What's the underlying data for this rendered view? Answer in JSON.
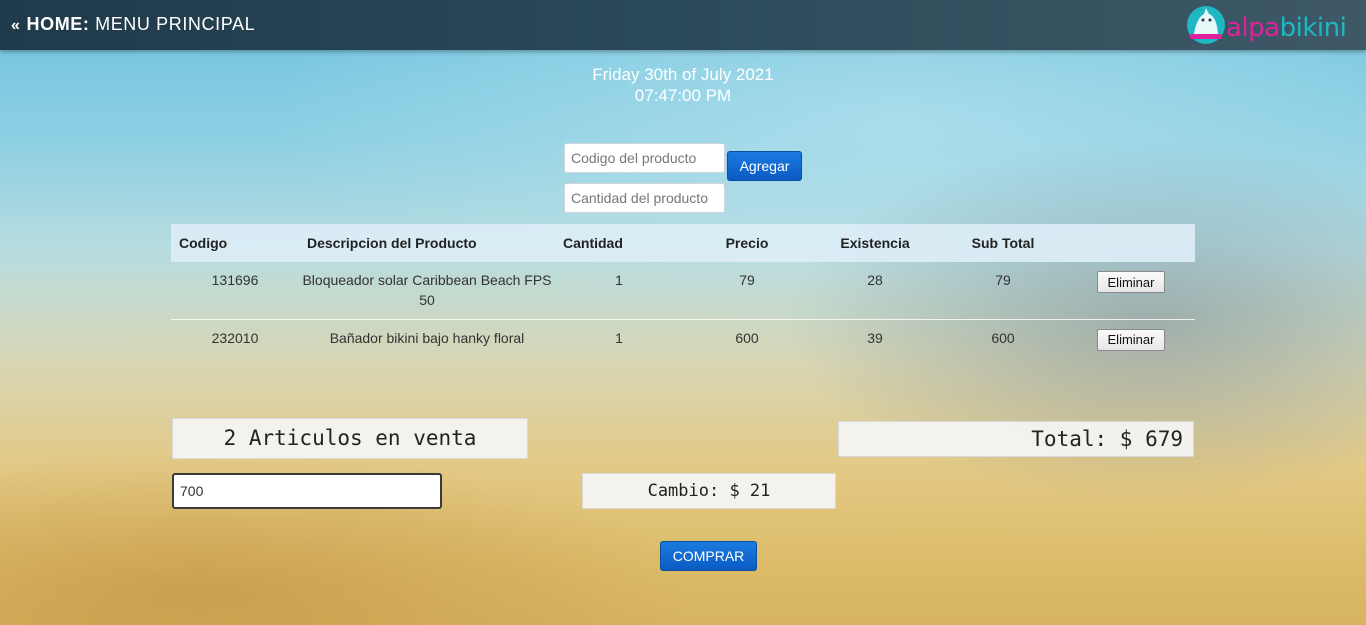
{
  "header": {
    "arrow": "«",
    "home_label": "HOME:",
    "menu_label": "MENU PRINCIPAL",
    "logo": {
      "alpa": "alpa",
      "bikini": "bikini",
      "icon": "alpaca-icon"
    }
  },
  "datetime": {
    "date": "Friday 30th of July 2021",
    "time": "07:47:00 PM"
  },
  "form": {
    "code_placeholder": "Codigo del producto",
    "qty_placeholder": "Cantidad del producto",
    "add_label": "Agregar"
  },
  "table": {
    "headers": [
      "Codigo",
      "Descripcion del Producto",
      "Cantidad",
      "Precio",
      "Existencia",
      "Sub Total"
    ],
    "rows": [
      {
        "code": "131696",
        "description": "Bloqueador solar Caribbean Beach FPS 50",
        "qty": "1",
        "price": "79",
        "stock": "28",
        "subtotal": "79",
        "action": "Eliminar"
      },
      {
        "code": "232010",
        "description": "Bañador bikini bajo hanky floral",
        "qty": "1",
        "price": "600",
        "stock": "39",
        "subtotal": "600",
        "action": "Eliminar"
      }
    ]
  },
  "summary": {
    "items_count": "2 Articulos en venta",
    "total": "Total: $ 679",
    "payment_value": "700",
    "change": "Cambio: $ 21",
    "buy_label": "COMPRAR"
  },
  "colors": {
    "button_blue": "#0b5bc4",
    "topbar": "#2b4a5a",
    "brand_pink": "#e0219a",
    "brand_teal": "#1fb7c4"
  }
}
